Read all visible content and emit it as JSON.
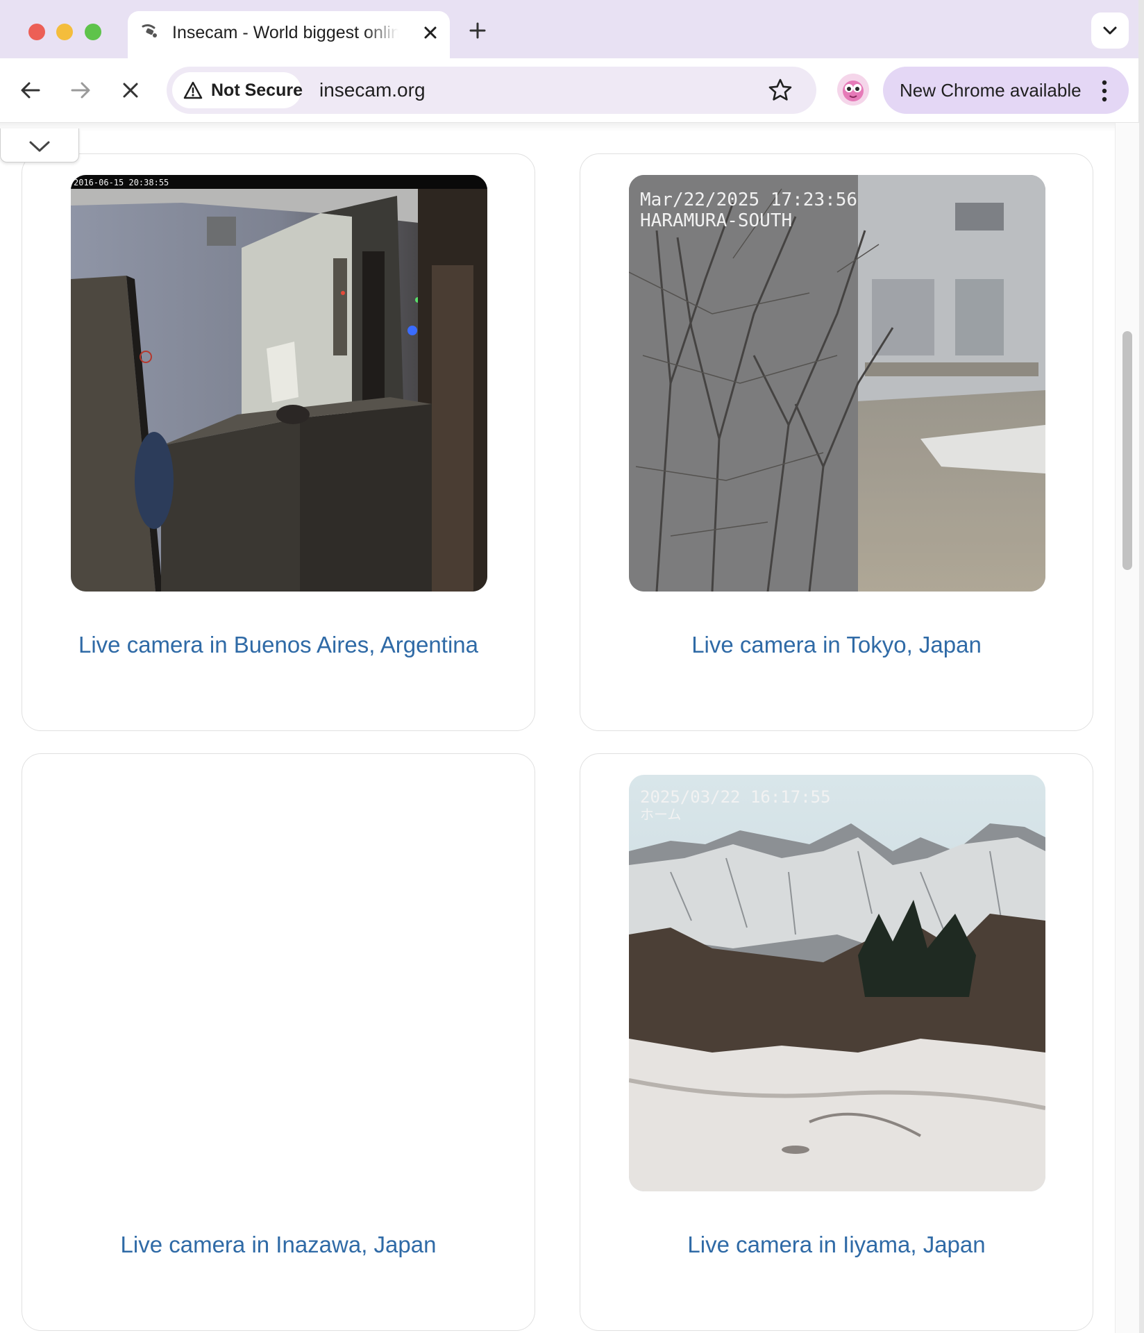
{
  "browser": {
    "tab_title": "Insecam - World biggest online",
    "security_label": "Not Secure",
    "url": "insecam.org",
    "update_label": "New Chrome available"
  },
  "cameras": [
    {
      "caption": "Live camera in Buenos Aires, Argentina",
      "overlay": "2016-06-15 20:38:55",
      "image": "server-room-feed"
    },
    {
      "caption": "Live camera in Tokyo, Japan",
      "overlay": "Mar/22/2025 17:23:56",
      "overlay2": "HARAMURA-SOUTH",
      "image": "bare-trees-building-feed"
    },
    {
      "caption": "Live camera in Inazawa, Japan",
      "image": ""
    },
    {
      "caption": "Live camera in Iiyama, Japan",
      "overlay": "2025/03/22  16:17:55",
      "overlay2": "ホーム",
      "image": "snowy-mountains-feed"
    }
  ],
  "colors": {
    "tab_strip": "#e8e1f3",
    "omnibox": "#efe9f5",
    "update_pill": "#e4d7f5",
    "link": "#2f6aa6"
  }
}
